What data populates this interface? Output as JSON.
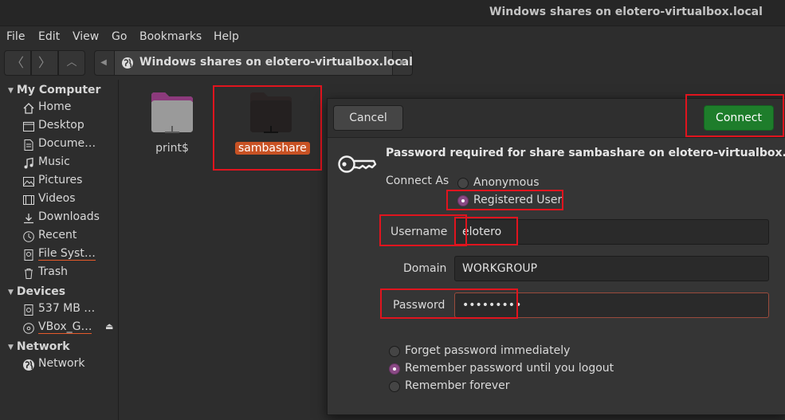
{
  "window": {
    "title": "Windows shares on elotero-virtualbox.local"
  },
  "menu": [
    "File",
    "Edit",
    "View",
    "Go",
    "Bookmarks",
    "Help"
  ],
  "pathbar": {
    "location": "Windows shares on elotero-virtualbox.local"
  },
  "sidebar": {
    "my_computer": {
      "header": "My Computer",
      "items": [
        {
          "label": "Home",
          "icon": "home-icon"
        },
        {
          "label": "Desktop",
          "icon": "desktop-icon"
        },
        {
          "label": "Docume…",
          "icon": "documents-icon"
        },
        {
          "label": "Music",
          "icon": "music-icon"
        },
        {
          "label": "Pictures",
          "icon": "pictures-icon"
        },
        {
          "label": "Videos",
          "icon": "videos-icon"
        },
        {
          "label": "Downloads",
          "icon": "downloads-icon"
        },
        {
          "label": "Recent",
          "icon": "recent-icon"
        },
        {
          "label": "File Syst…",
          "icon": "drive-icon"
        },
        {
          "label": "Trash",
          "icon": "trash-icon"
        }
      ]
    },
    "devices": {
      "header": "Devices",
      "items": [
        {
          "label": "537 MB …",
          "icon": "drive-icon"
        },
        {
          "label": "VBox_G…",
          "icon": "optical-disc-icon"
        }
      ]
    },
    "network": {
      "header": "Network",
      "items": [
        {
          "label": "Network",
          "icon": "network-icon"
        }
      ]
    }
  },
  "files": [
    {
      "name": "print$",
      "selected": false
    },
    {
      "name": "sambashare",
      "selected": true
    }
  ],
  "dialog": {
    "cancel_label": "Cancel",
    "connect_label": "Connect",
    "message": "Password required for share sambashare on elotero-virtualbox.local",
    "connect_as_label": "Connect As",
    "connect_as_options": [
      "Anonymous",
      "Registered User"
    ],
    "connect_as_selected": "Registered User",
    "username_label": "Username",
    "username_value": "elotero",
    "domain_label": "Domain",
    "domain_value": "WORKGROUP",
    "password_label": "Password",
    "password_value": "•••••••••",
    "remember_options": [
      "Forget password immediately",
      "Remember password until you logout",
      "Remember forever"
    ],
    "remember_selected": "Remember password until you logout"
  },
  "colors": {
    "accent": "#8a4a85",
    "connect_button": "#1e7d2b",
    "selection": "#e95420",
    "highlight_box": "#e0141e"
  }
}
